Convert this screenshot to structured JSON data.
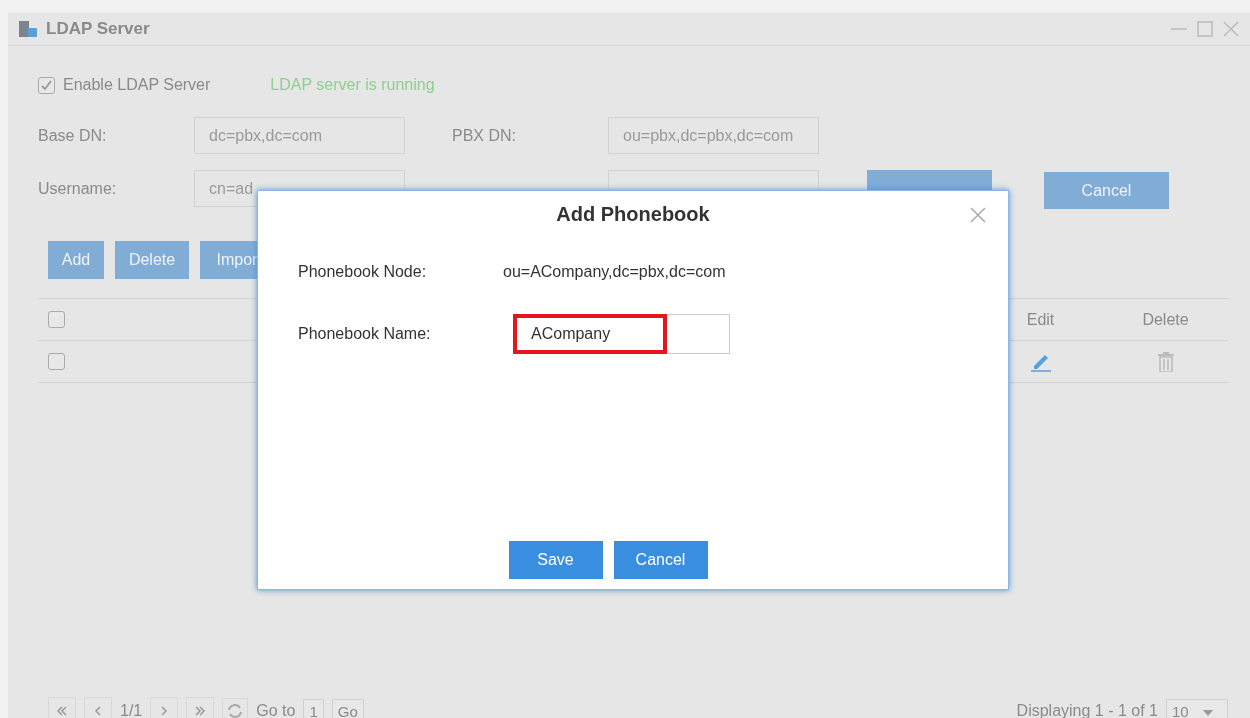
{
  "window": {
    "title": "LDAP Server"
  },
  "server": {
    "enable_label": "Enable LDAP Server",
    "enabled": true,
    "status": "LDAP server is running"
  },
  "fields": [
    {
      "label": "Base DN:",
      "value": "dc=pbx,dc=com"
    },
    {
      "label": "PBX DN:",
      "value": "ou=pbx,dc=pbx,dc=com"
    },
    {
      "label": "Username:",
      "value": "cn=ad"
    }
  ],
  "form_buttons": [
    "Cancel"
  ],
  "toolbar": [
    "Add",
    "Delete",
    "Impor"
  ],
  "table": {
    "columns": [
      "Edit",
      "Delete"
    ],
    "rows": [
      {
        "checked": false
      }
    ],
    "all_checked": false
  },
  "pagination": {
    "page": "1/1",
    "goto_label": "Go to",
    "goto_value": "1",
    "go": "Go",
    "displaying": "Displaying 1 - 1 of 1",
    "page_size": "10"
  },
  "dialog": {
    "title": "Add Phonebook",
    "node_label": "Phonebook Node:",
    "node_value": "ou=ACompany,dc=pbx,dc=com",
    "name_label": "Phonebook Name:",
    "name_value": "ACompany",
    "highlighted": true,
    "buttons": [
      "Save",
      "Cancel"
    ]
  }
}
